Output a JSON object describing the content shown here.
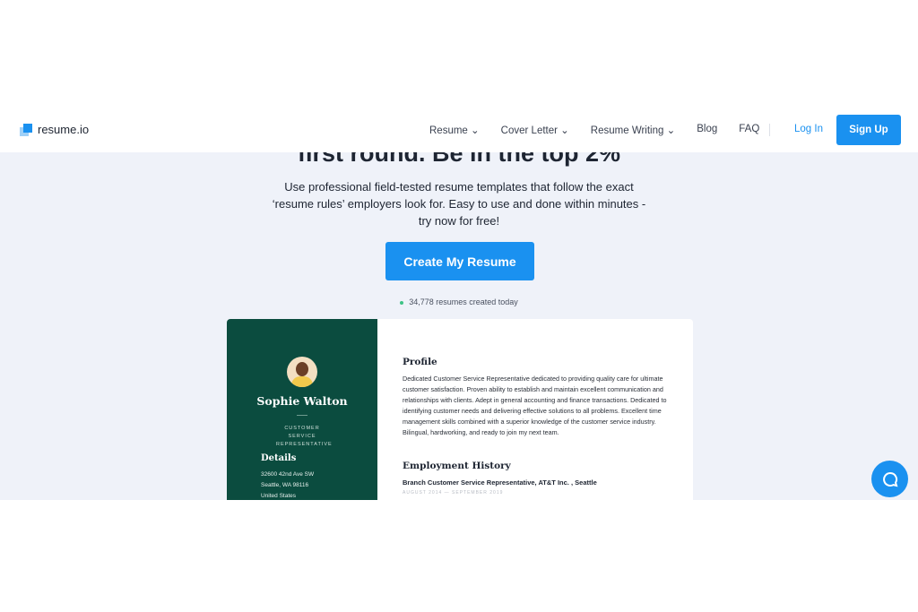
{
  "nav": {
    "logo": "resume.io",
    "menu": [
      {
        "label": "Resume",
        "dropdown": true
      },
      {
        "label": "Cover Letter",
        "dropdown": true
      },
      {
        "label": "Resume Writing",
        "dropdown": true
      },
      {
        "label": "Blog",
        "dropdown": false
      },
      {
        "label": "FAQ",
        "dropdown": false
      }
    ],
    "login": "Log In",
    "signup": "Sign Up"
  },
  "hero": {
    "headline": "first round. Be in the top 2%",
    "subtitle": "Use professional field-tested resume templates that follow the exact ‘resume rules’ employers look for. Easy to use and done within minutes - try now for free!",
    "cta": "Create My Resume",
    "count": "34,778 resumes created today"
  },
  "resume": {
    "name": "Sophie Walton",
    "role": "CUSTOMER SERVICE REPRESENTATIVE",
    "details_heading": "Details",
    "address": [
      "32600 42nd Ave SW",
      "Seattle, WA 98116",
      "United States"
    ],
    "profile_heading": "Profile",
    "profile_text": "Dedicated Customer Service Representative dedicated to providing quality care for ultimate customer satisfaction. Proven ability to establish and maintain excellent communication and relationships with clients. Adept in general accounting and finance transactions. Dedicated to identifying customer needs and delivering effective solutions to all problems. Excellent time management skills combined with a superior knowledge of the customer service industry. Bilingual, hardworking, and ready to join my next team.",
    "employment_heading": "Employment History",
    "job_title": "Branch Customer Service Representative, AT&T Inc. , Seattle",
    "job_dates": "AUGUST 2014 — SEPTEMBER 2019"
  },
  "colors": {
    "accent": "#1a91f0",
    "sidebar": "#0b4c3f",
    "hero_bg": "#eff2f9"
  },
  "icons": {
    "chat": "chat-bubble-icon",
    "dropdown": "chevron-down-icon"
  }
}
